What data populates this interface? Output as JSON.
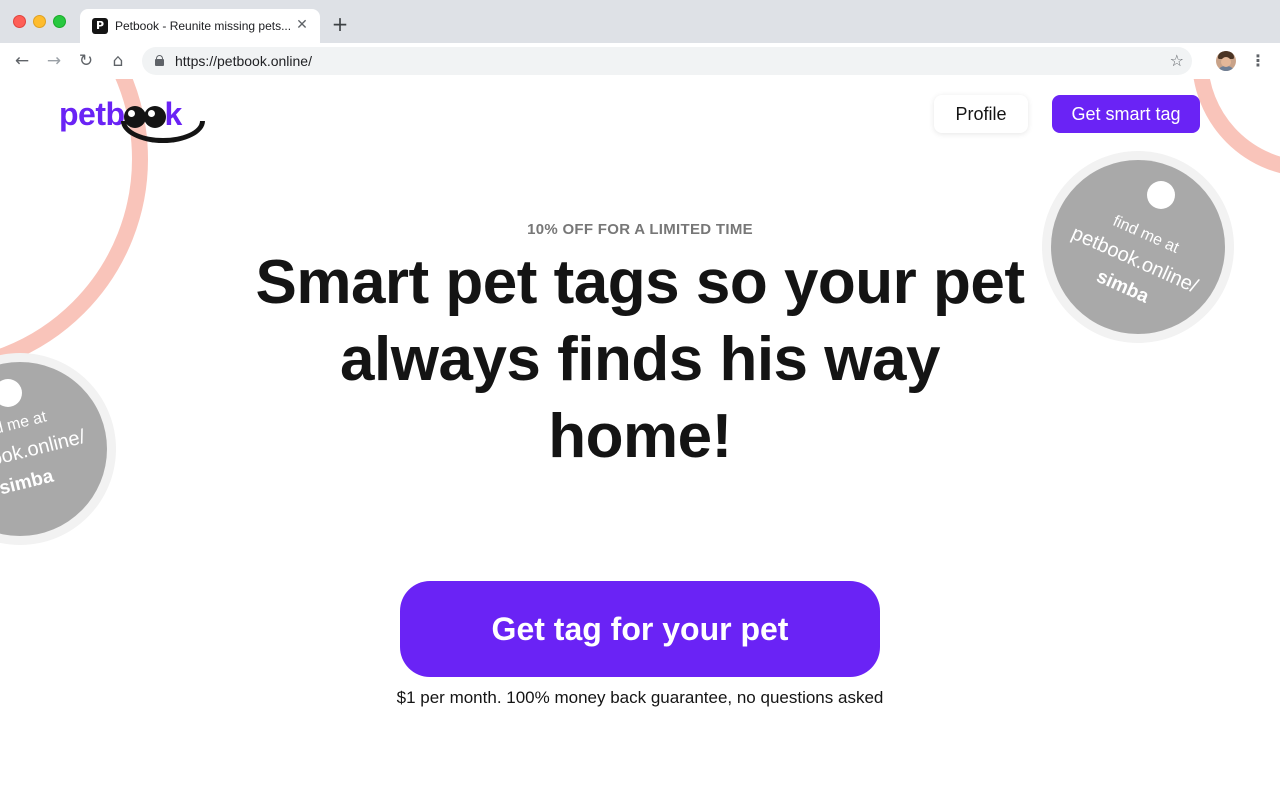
{
  "browser": {
    "tab_title": "Petbook - Reunite missing pets...",
    "tab_favicon": "P",
    "url": "https://petbook.online/"
  },
  "icons": {
    "back": "back-arrow-icon",
    "forward": "forward-arrow-icon",
    "reload": "reload-icon",
    "home": "home-icon",
    "lock": "lock-icon",
    "star": "star-icon",
    "avatar": "user-avatar",
    "menu": "kebab-menu-icon",
    "close": "close-icon",
    "new_tab": "plus-icon"
  },
  "header": {
    "logo_text": "petbook",
    "profile_label": "Profile",
    "smart_tag_label": "Get smart tag"
  },
  "hero": {
    "kicker": "10% OFF FOR A LIMITED TIME",
    "headline": "Smart pet tags so your pet always finds his way home!",
    "cta_label": "Get tag for your pet",
    "fineprint": "$1 per month. 100% money back guarantee, no questions asked"
  },
  "decor_tag": {
    "line1": "find me at",
    "line2": "petbook.online/",
    "line3": "simba"
  },
  "colors": {
    "brand": "#6a23f5",
    "ink": "#141414",
    "tag_grey": "#a9a9a9",
    "ring_pink": "#f9c4ba"
  }
}
